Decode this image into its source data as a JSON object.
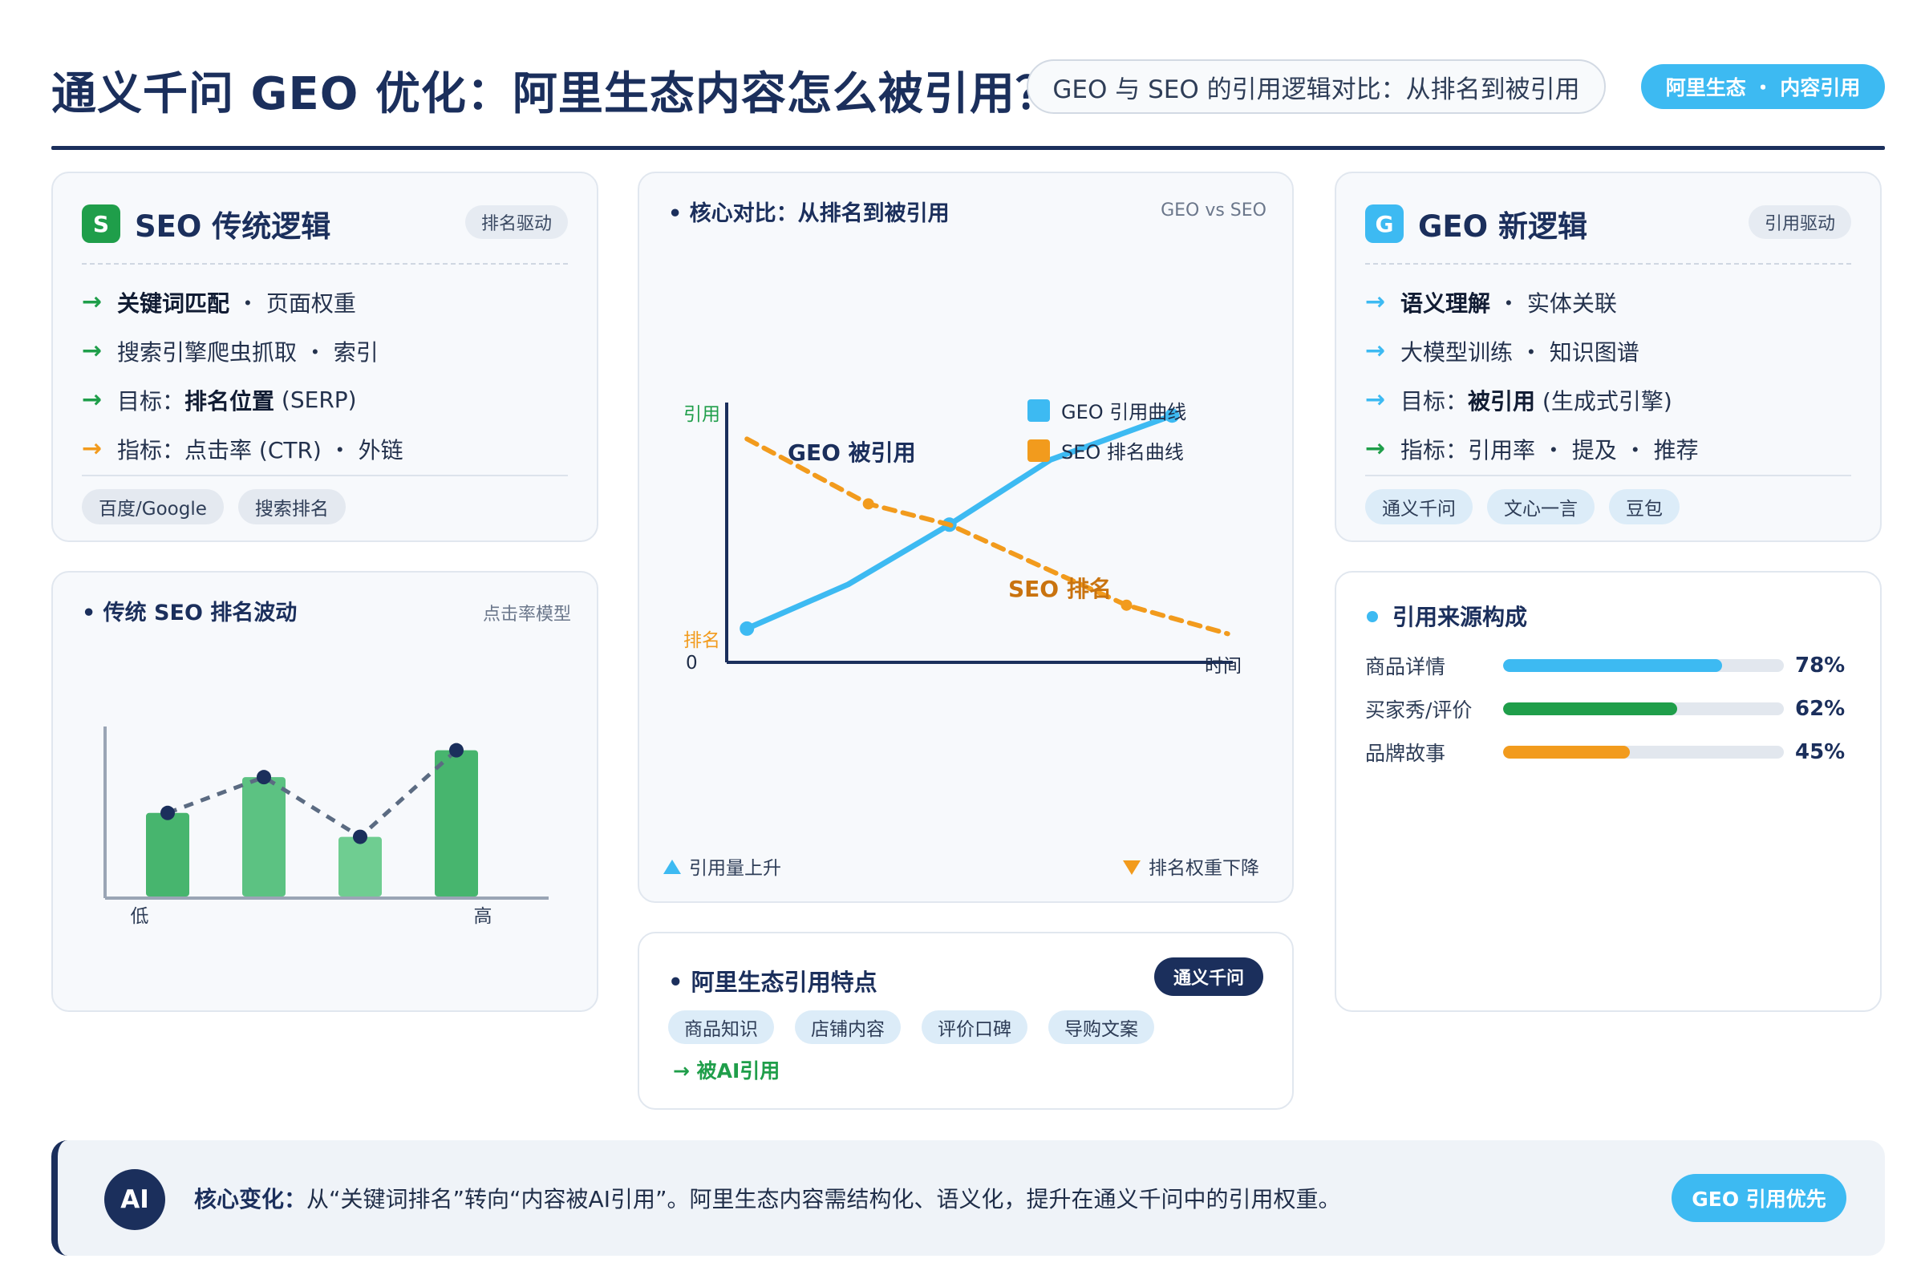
{
  "header": {
    "title": "通义千问 GEO 优化：阿里生态内容怎么被引用？",
    "subtitle": "GEO 与 SEO 的引用逻辑对比：从排名到被引用",
    "tag": "阿里生态 ・ 内容引用"
  },
  "seo_card": {
    "badge": "S",
    "title": "SEO 传统逻辑",
    "chip": "排名驱动",
    "bullets": [
      {
        "bold": "关键词匹配",
        "rest": " ・ 页面权重"
      },
      {
        "bold": "",
        "rest": "搜索引擎爬虫抓取 ・ 索引"
      },
      {
        "pre": "目标：",
        "bold": "排名位置",
        "rest": " (SERP)"
      },
      {
        "bold": "",
        "rest": "指标：点击率 (CTR) ・ 外链"
      }
    ],
    "tags": [
      "百度/Google",
      "搜索排名"
    ],
    "arrow_colors": [
      "#1f9e4a",
      "#1f9e4a",
      "#1f9e4a",
      "#f29b1d"
    ]
  },
  "geo_card": {
    "badge": "G",
    "title": "GEO 新逻辑",
    "chip": "引用驱动",
    "bullets": [
      {
        "bold": "语义理解",
        "rest": " ・ 实体关联"
      },
      {
        "bold": "",
        "rest": "大模型训练 ・ 知识图谱"
      },
      {
        "pre": "目标：",
        "bold": "被引用",
        "rest": " (生成式引擎)"
      },
      {
        "bold": "",
        "rest": "指标：引用率 ・ 提及 ・ 推荐"
      }
    ],
    "tags": [
      "通义千问",
      "文心一言",
      "豆包"
    ],
    "arrow_colors": [
      "#3dbaf2",
      "#3dbaf2",
      "#3dbaf2",
      "#1f9e4a"
    ]
  },
  "seo_chart": {
    "title": "• 传统 SEO 排名波动",
    "note": "点击率模型",
    "chart_data": {
      "type": "bar",
      "categories": [
        "1",
        "2",
        "3",
        "4"
      ],
      "values": [
        56,
        80,
        40,
        98
      ],
      "ylim": [
        0,
        115
      ],
      "x_tick_labels": [
        "低",
        "高"
      ],
      "line_overlay": true,
      "bar_colors": [
        "#47b56e",
        "#5cc282",
        "#6fcd91",
        "#47b56e"
      ]
    }
  },
  "compare_chart": {
    "title": "• 核心对比：从排名到被引用",
    "note": "GEO vs SEO",
    "chart_data": {
      "type": "line",
      "ylabel_top": "引用",
      "ylabel_bottom": "排名",
      "origin_label": "0",
      "xlabel": "时间",
      "xlim": [
        0,
        10
      ],
      "ylim": [
        0,
        10
      ],
      "series": [
        {
          "name": "GEO 引用曲线",
          "color": "#3dbaf2",
          "style": "solid",
          "x": [
            0.4,
            2.4,
            4.4,
            6.4,
            8.8
          ],
          "y": [
            1.3,
            3.0,
            5.3,
            7.8,
            9.5
          ]
        },
        {
          "name": "SEO 排名曲线",
          "color": "#f29b1d",
          "style": "dashed",
          "x": [
            0.4,
            2.8,
            4.4,
            7.9,
            9.9
          ],
          "y": [
            8.6,
            6.1,
            5.3,
            2.2,
            1.1
          ]
        }
      ],
      "annotations": [
        {
          "text": "GEO 被引用",
          "color": "#1b2f5c"
        },
        {
          "text": "SEO 排名",
          "color": "#c9730f"
        }
      ]
    },
    "foot_left": "引用量上升",
    "foot_right": "排名权重下降"
  },
  "sources": {
    "title": "引用来源构成",
    "items": [
      {
        "label": "商品详情",
        "value": 78,
        "display": "78%",
        "color": "#3dbaf2"
      },
      {
        "label": "买家秀/评价",
        "value": 62,
        "display": "62%",
        "color": "#1f9e4a"
      },
      {
        "label": "品牌故事",
        "value": 45,
        "display": "45%",
        "color": "#f29b1d"
      }
    ]
  },
  "ali": {
    "title": "• 阿里生态引用特点",
    "badge": "通义千问",
    "chips": [
      "商品知识",
      "店铺内容",
      "评价口碑",
      "导购文案"
    ],
    "result": "→ 被AI引用"
  },
  "footer": {
    "badge": "AI",
    "lead": "核心变化：",
    "text": "从“关键词排名”转向“内容被AI引用”。阿里生态内容需结构化、语义化，提升在通义千问中的引用权重。",
    "button": "GEO 引用优先"
  },
  "colors": {
    "navy": "#1b2f5c",
    "sky": "#3dbaf2",
    "green": "#1f9e4a",
    "orange": "#f29b1d"
  }
}
